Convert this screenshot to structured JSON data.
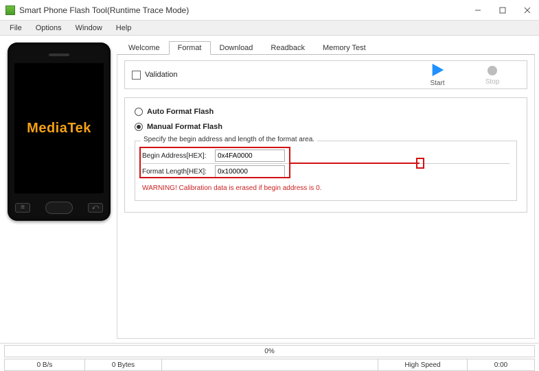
{
  "window": {
    "title": "Smart Phone Flash Tool(Runtime Trace Mode)"
  },
  "menu": {
    "file": "File",
    "options": "Options",
    "window": "Window",
    "help": "Help"
  },
  "tabs": {
    "welcome": "Welcome",
    "format": "Format",
    "download": "Download",
    "readback": "Readback",
    "memorytest": "Memory Test",
    "active": "format"
  },
  "toolbar": {
    "validation_label": "Validation",
    "start_label": "Start",
    "stop_label": "Stop"
  },
  "format": {
    "auto_label": "Auto Format Flash",
    "manual_label": "Manual Format Flash",
    "selected": "manual",
    "legend": "Specify the begin address and length of the format area.",
    "begin_label": "Begin Address[HEX]:",
    "begin_value": "0x4FA0000",
    "length_label": "Format Length[HEX]:",
    "length_value": "0x100000",
    "warning": "WARNING! Calibration data is erased if begin address is 0."
  },
  "phone": {
    "brand": "MediaTek"
  },
  "status": {
    "progress": "0%",
    "rate": "0 B/s",
    "bytes": "0 Bytes",
    "conn": "High Speed",
    "time": "0:00"
  }
}
